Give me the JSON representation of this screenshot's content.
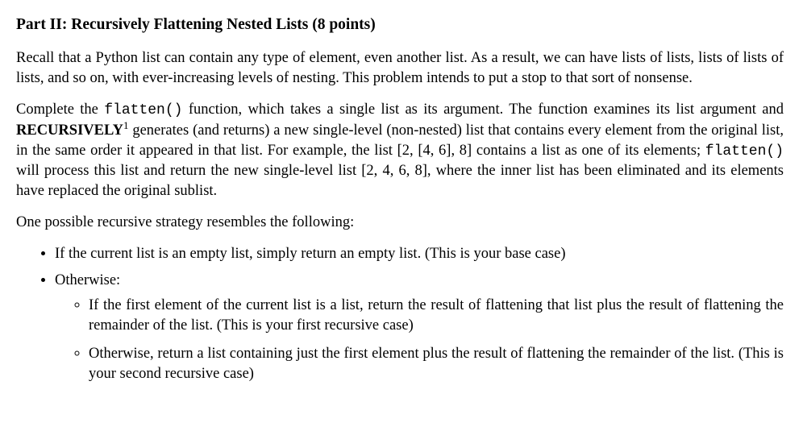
{
  "title": "Part II: Recursively Flattening Nested Lists (8 points)",
  "para1": "Recall that a Python list can contain any type of element, even another list. As a result, we can have lists of lists, lists of lists of lists, and so on, with ever-increasing levels of nesting. This problem intends to put a stop to that sort of nonsense.",
  "para2": {
    "seg1": "Complete the ",
    "code1": "flatten()",
    "seg2": " function, which takes a single list as its argument. The function examines its list argument and ",
    "strong": "RECURSIVELY",
    "sup": "1",
    "seg3": " generates (and returns) a new single-level (non-nested) list that contains every element from the original list, in the same order it appeared in that list. For example, the list [2, [4, 6], 8] contains a list as one of its elements; ",
    "code2": "flatten()",
    "seg4": " will process this list and return the new single-level list [2, 4, 6, 8], where the inner list has been eliminated and its elements have replaced the original sublist."
  },
  "para3": "One possible recursive strategy resembles the following:",
  "bullets": {
    "b1": "If the current list is an empty list, simply return an empty list. (This is your base case)",
    "b2": "Otherwise:",
    "sub1": "If the first element of the current list is a list, return the result of flattening that list plus the result of flattening the remainder of the list. (This is your first recursive case)",
    "sub2": "Otherwise, return a list containing just the first element plus the result of flattening the remainder of the list. (This is your second recursive case)"
  }
}
